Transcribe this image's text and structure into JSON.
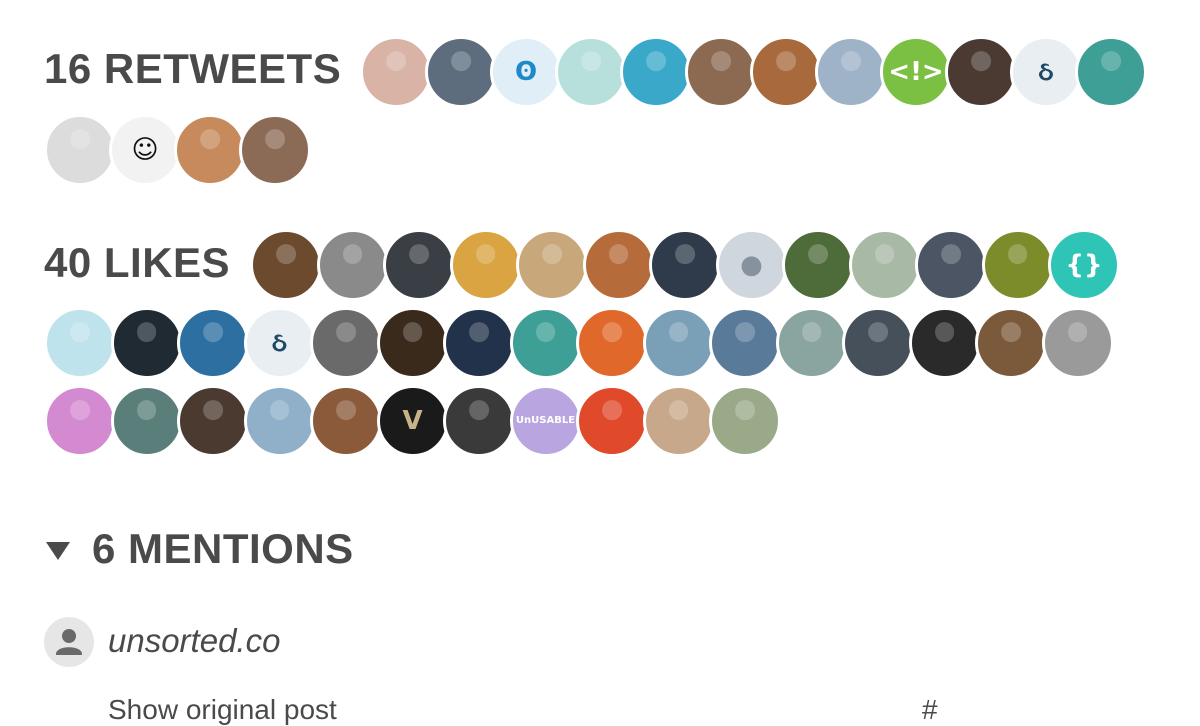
{
  "retweets": {
    "heading": "16 RETWEETS",
    "avatars": [
      {
        "color": "#d8b3a6",
        "glyph": ""
      },
      {
        "color": "#5d6d7e",
        "glyph": ""
      },
      {
        "color": "#dfeef7",
        "glyph": "ʘ",
        "glyph_color": "#1e88c8"
      },
      {
        "color": "#b7e0dd",
        "glyph": ""
      },
      {
        "color": "#3aa9c9",
        "glyph": ""
      },
      {
        "color": "#8c6a52",
        "glyph": ""
      },
      {
        "color": "#a86a3d",
        "glyph": ""
      },
      {
        "color": "#9eb3c8",
        "glyph": ""
      },
      {
        "color": "#7bc043",
        "glyph": "<!>",
        "glyph_color": "#ffffff"
      },
      {
        "color": "#4a3a32",
        "glyph": ""
      },
      {
        "color": "#e8eef2",
        "glyph": "ઠ",
        "glyph_color": "#1e4a63"
      },
      {
        "color": "#3d9f95",
        "glyph": ""
      },
      {
        "color": "#dcdcdc",
        "glyph": ""
      },
      {
        "color": "#f2f2f2",
        "glyph": "☺",
        "glyph_color": "#111111"
      },
      {
        "color": "#c68a5c",
        "glyph": ""
      },
      {
        "color": "#8b6b55",
        "glyph": ""
      }
    ]
  },
  "likes": {
    "heading": "40 LIKES",
    "avatars": [
      {
        "color": "#6b4a2e",
        "glyph": ""
      },
      {
        "color": "#8a8a8a",
        "glyph": ""
      },
      {
        "color": "#3a3f45",
        "glyph": ""
      },
      {
        "color": "#d9a441",
        "glyph": ""
      },
      {
        "color": "#c8a87a",
        "glyph": ""
      },
      {
        "color": "#b66b3a",
        "glyph": ""
      },
      {
        "color": "#2f3b4a",
        "glyph": ""
      },
      {
        "color": "#cfd6dd",
        "glyph": "●",
        "glyph_color": "#8593a1"
      },
      {
        "color": "#4e6b3a",
        "glyph": ""
      },
      {
        "color": "#a8b9a6",
        "glyph": ""
      },
      {
        "color": "#4b5563",
        "glyph": ""
      },
      {
        "color": "#7c8c2a",
        "glyph": ""
      },
      {
        "color": "#2ec4b6",
        "glyph": "{}",
        "glyph_color": "#ffffff"
      },
      {
        "color": "#bfe3ec",
        "glyph": ""
      },
      {
        "color": "#1f2a33",
        "glyph": ""
      },
      {
        "color": "#2c6fa0",
        "glyph": ""
      },
      {
        "color": "#e8eef2",
        "glyph": "ઠ",
        "glyph_color": "#1e4a63"
      },
      {
        "color": "#6a6a6a",
        "glyph": ""
      },
      {
        "color": "#3a2a1c",
        "glyph": ""
      },
      {
        "color": "#22324a",
        "glyph": ""
      },
      {
        "color": "#3d9f95",
        "glyph": ""
      },
      {
        "color": "#e0682a",
        "glyph": ""
      },
      {
        "color": "#7aa0b8",
        "glyph": ""
      },
      {
        "color": "#5a7a9a",
        "glyph": ""
      },
      {
        "color": "#8aa5a0",
        "glyph": ""
      },
      {
        "color": "#45505a",
        "glyph": ""
      },
      {
        "color": "#2a2a2a",
        "glyph": ""
      },
      {
        "color": "#7a5a3a",
        "glyph": ""
      },
      {
        "color": "#9a9a9a",
        "glyph": ""
      },
      {
        "color": "#d48ad0",
        "glyph": ""
      },
      {
        "color": "#5a7f7a",
        "glyph": ""
      },
      {
        "color": "#4a3a30",
        "glyph": ""
      },
      {
        "color": "#8fb0c8",
        "glyph": ""
      },
      {
        "color": "#8a5a3a",
        "glyph": ""
      },
      {
        "color": "#1a1a1a",
        "glyph": "V",
        "glyph_color": "#c8b28a"
      },
      {
        "color": "#3a3a3a",
        "glyph": ""
      },
      {
        "color": "#b9a6e0",
        "glyph": "UnUSABLE",
        "glyph_color": "#ffffff",
        "glyph_size": 10
      },
      {
        "color": "#e04a2a",
        "glyph": ""
      },
      {
        "color": "#c8a88a",
        "glyph": ""
      },
      {
        "color": "#9aaa88",
        "glyph": ""
      }
    ]
  },
  "mentions": {
    "heading": "6 MENTIONS",
    "toggle_icon": "triangle-down-icon",
    "items": [
      {
        "author": "unsorted.co",
        "avatar_icon": "user-icon",
        "show_original": "Show original post",
        "permalink": "#"
      }
    ]
  }
}
